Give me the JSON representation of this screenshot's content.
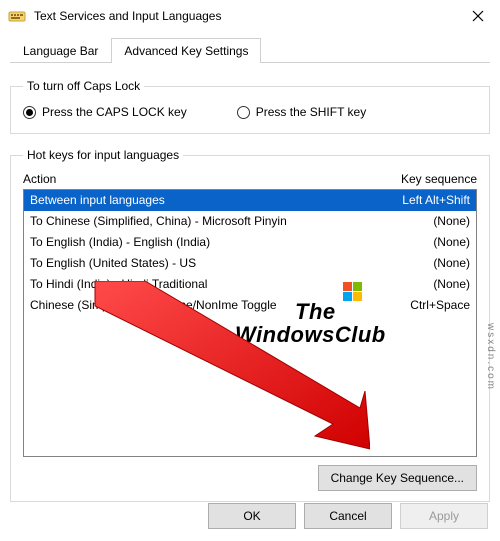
{
  "window": {
    "title": "Text Services and Input Languages"
  },
  "tabs": {
    "lang_bar": "Language Bar",
    "adv_key": "Advanced Key Settings"
  },
  "caps_group": {
    "legend": "To turn off Caps Lock",
    "opt_caps": "Press the CAPS LOCK key",
    "opt_shift": "Press the SHIFT key"
  },
  "hotkeys_group": {
    "legend": "Hot keys for input languages",
    "col_action": "Action",
    "col_keyseq": "Key sequence",
    "rows": [
      {
        "action": "Between input languages",
        "seq": "Left Alt+Shift"
      },
      {
        "action": "To Chinese (Simplified, China) - Microsoft Pinyin",
        "seq": "(None)"
      },
      {
        "action": "To English (India) - English (India)",
        "seq": "(None)"
      },
      {
        "action": "To English (United States) - US",
        "seq": "(None)"
      },
      {
        "action": "To Hindi (India) - Hindi Traditional",
        "seq": "(None)"
      },
      {
        "action": "Chinese (Simplified) IME - Ime/NonIme Toggle",
        "seq": "Ctrl+Space"
      }
    ],
    "change_btn": "Change Key Sequence..."
  },
  "buttons": {
    "ok": "OK",
    "cancel": "Cancel",
    "apply": "Apply"
  },
  "watermark": {
    "line1": "The",
    "line2": "WindowsClub",
    "side": "wsxdn.com"
  }
}
